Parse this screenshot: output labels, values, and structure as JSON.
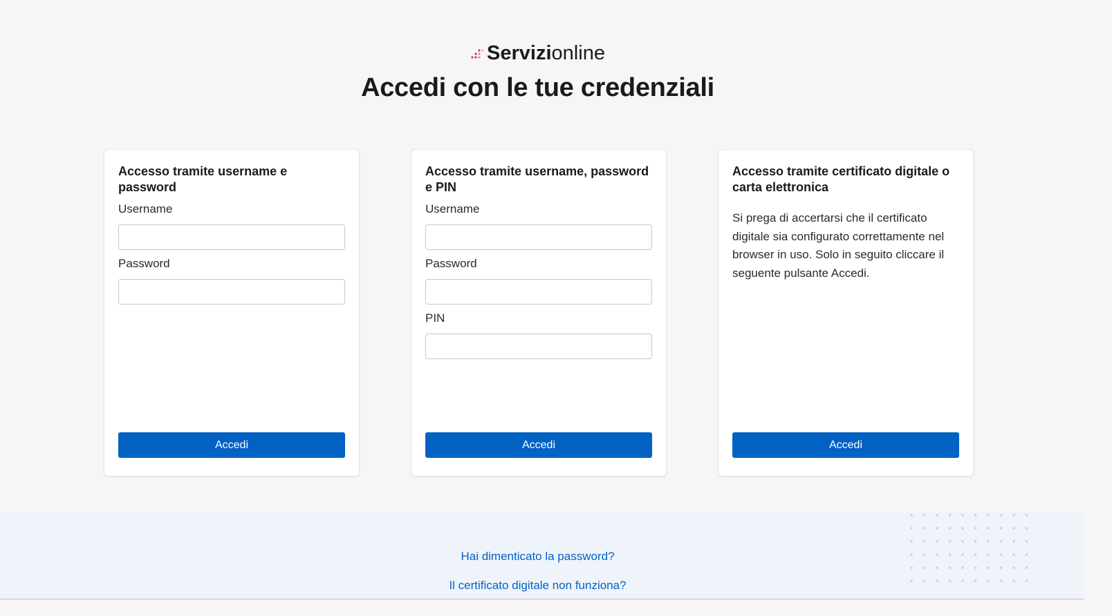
{
  "brand": {
    "name_bold": "Servizi",
    "name_light": "online",
    "mark_color_primary": "#d9364c",
    "mark_color_secondary": "#e88a98"
  },
  "page": {
    "title": "Accedi con le tue credenziali"
  },
  "colors": {
    "accent": "#0262c4",
    "background": "#f6f6f6",
    "footer_background": "#eff4fb"
  },
  "cards": [
    {
      "title": "Accesso tramite username e password",
      "fields": [
        {
          "label": "Username",
          "value": "",
          "placeholder": ""
        },
        {
          "label": "Password",
          "value": "",
          "placeholder": ""
        }
      ],
      "button_label": "Accedi"
    },
    {
      "title": "Accesso tramite username, password e PIN",
      "fields": [
        {
          "label": "Username",
          "value": "",
          "placeholder": ""
        },
        {
          "label": "Password",
          "value": "",
          "placeholder": ""
        },
        {
          "label": "PIN",
          "value": "",
          "placeholder": ""
        }
      ],
      "button_label": "Accedi"
    },
    {
      "title": "Accesso tramite certificato digitale o carta elettronica",
      "description": "Si prega di accertarsi che il certificato digitale sia configurato correttamente nel browser in uso. Solo in seguito cliccare il seguente pulsante Accedi.",
      "button_label": "Accedi"
    }
  ],
  "footer": {
    "links": [
      {
        "label": "Hai dimenticato la password?"
      },
      {
        "label": "Il certificato digitale non funziona?"
      }
    ]
  }
}
